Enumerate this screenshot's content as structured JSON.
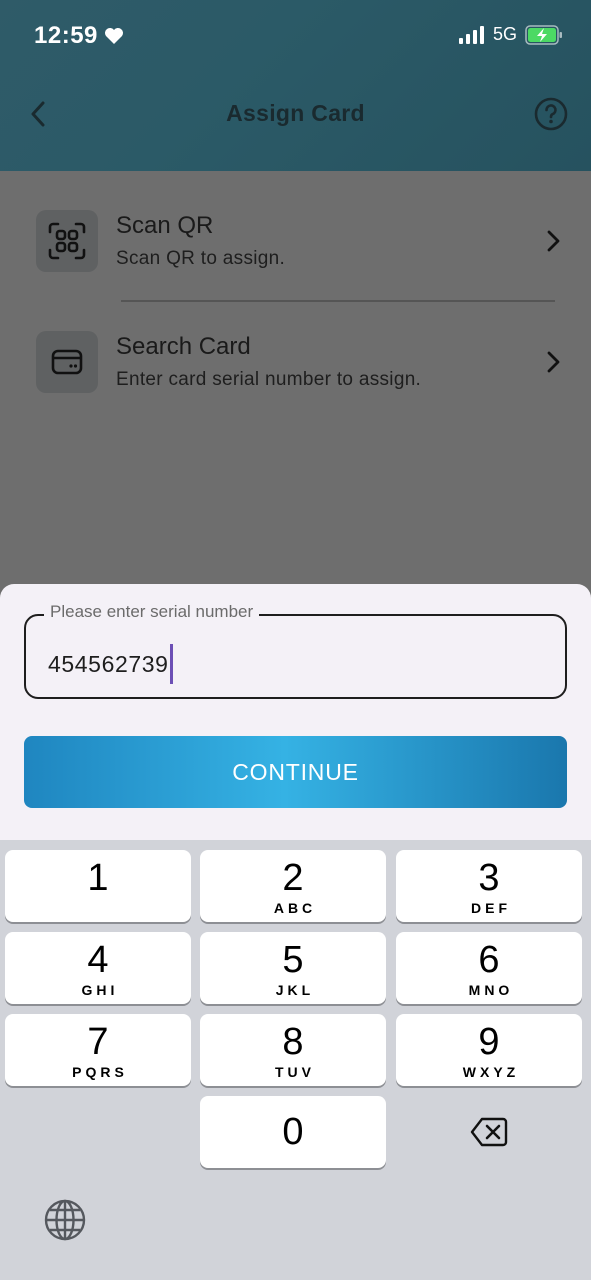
{
  "status_bar": {
    "time": "12:59",
    "network": "5G"
  },
  "nav": {
    "title": "Assign Card"
  },
  "options": [
    {
      "title": "Scan QR",
      "subtitle": "Scan QR to assign.",
      "icon": "qr-scan-icon"
    },
    {
      "title": "Search Card",
      "subtitle": "Enter card serial number to assign.",
      "icon": "card-icon"
    }
  ],
  "serial_input": {
    "label": "Please enter serial number",
    "value": "454562739"
  },
  "continue_label": "CONTINUE",
  "keypad": [
    {
      "num": "1",
      "letters": ""
    },
    {
      "num": "2",
      "letters": "ABC"
    },
    {
      "num": "3",
      "letters": "DEF"
    },
    {
      "num": "4",
      "letters": "GHI"
    },
    {
      "num": "5",
      "letters": "JKL"
    },
    {
      "num": "6",
      "letters": "MNO"
    },
    {
      "num": "7",
      "letters": "PQRS"
    },
    {
      "num": "8",
      "letters": "TUV"
    },
    {
      "num": "9",
      "letters": "WXYZ"
    },
    {
      "num": "0",
      "letters": ""
    }
  ],
  "colors": {
    "header": "#2b5a67",
    "accent": "#35b2e4",
    "caret": "#6c4fb5"
  }
}
